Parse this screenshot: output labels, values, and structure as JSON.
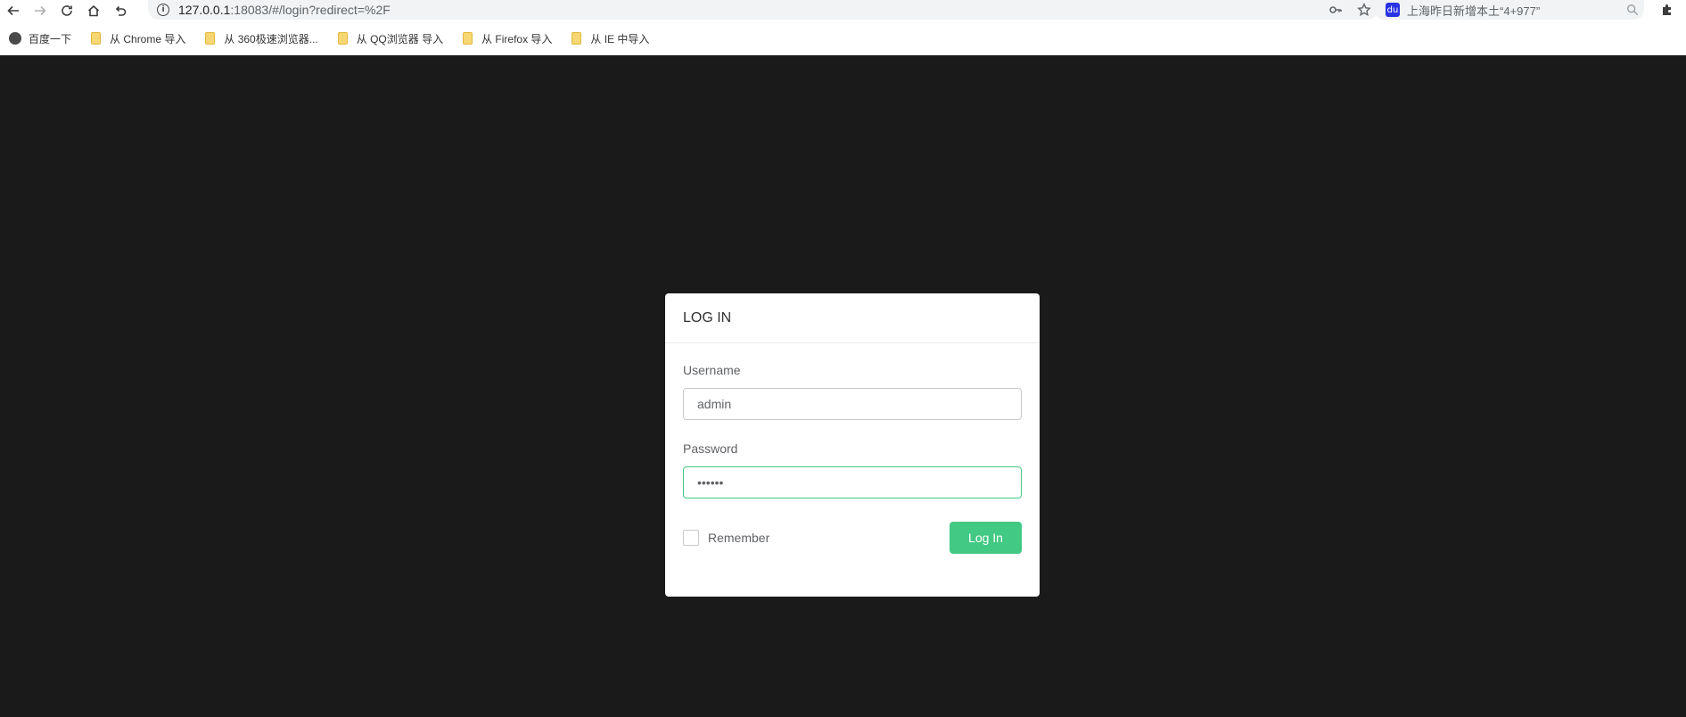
{
  "browser": {
    "url_host": "127.0.0.1",
    "url_rest": ":18083/#/login?redirect=%2F",
    "search_text": "上海昨日新增本土“4+977”",
    "baidu_icon_glyph": "du"
  },
  "bookmarks": [
    {
      "label": "百度一下",
      "type": "globe"
    },
    {
      "label": "从 Chrome 导入",
      "type": "folder"
    },
    {
      "label": "从 360极速浏览器...",
      "type": "folder"
    },
    {
      "label": "从 QQ浏览器 导入",
      "type": "folder"
    },
    {
      "label": "从 Firefox 导入",
      "type": "folder"
    },
    {
      "label": "从 IE 中导入",
      "type": "folder"
    }
  ],
  "login": {
    "title": "LOG IN",
    "username_label": "Username",
    "username_value": "admin",
    "password_label": "Password",
    "password_value": "••••••",
    "remember_label": "Remember",
    "submit_label": "Log In"
  },
  "colors": {
    "accent": "#42c983",
    "page_background": "#1a1a1a"
  }
}
